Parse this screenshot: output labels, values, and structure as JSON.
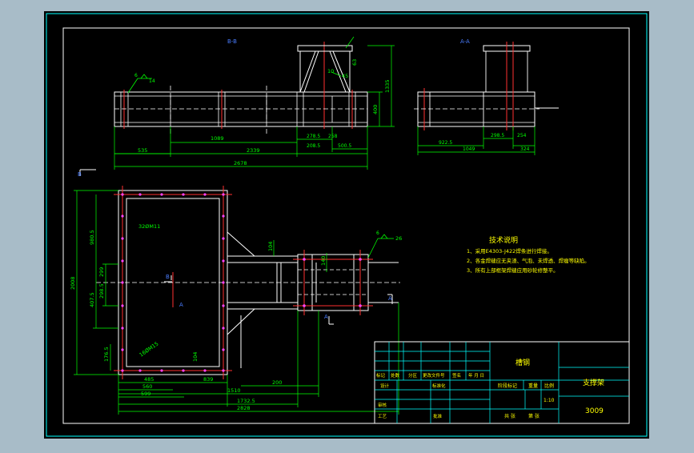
{
  "colors": {
    "background": "#a8bcc8",
    "canvas": "#000000",
    "frame": "#00ffff",
    "drawing": "#ffffff",
    "dimension": "#00ff00",
    "centerline": "#ff0000",
    "note_text": "#ffff00",
    "label_blue": "#4a7dff",
    "holes": "#ff00ff"
  },
  "views": {
    "front_label": "B-B",
    "side_label": "A-A",
    "section_a": "A",
    "section_b": "B"
  },
  "front_view": {
    "weld_symbol": "14",
    "weld_symbol_2": "6",
    "dims": {
      "d1089": "1089",
      "d2339": "2339",
      "d2678": "2678",
      "d535": "535",
      "d278_5": "278.5",
      "d258": "258",
      "d208_5": "208.5",
      "d500_5": "500.5",
      "d1335": "1335",
      "d400": "400",
      "d10": "10",
      "d45": "45",
      "d63": "63"
    }
  },
  "side_view": {
    "dims": {
      "d922_5": "922.5",
      "d1049": "1049",
      "d298_5": "298.5",
      "d254": "254",
      "d324": "324"
    }
  },
  "plan_view": {
    "hole_label_top": "32ØM11",
    "hole_label_bottom": "16ØM15",
    "weld_symbol": "26",
    "weld_symbol_2": "6",
    "dims": {
      "d2008": "2008",
      "d980_5": "980.5",
      "d407_5": "407.5",
      "d299": "299",
      "d298_5": "298.5",
      "d176_5": "176.5",
      "d485": "485",
      "d560": "560",
      "d599": "599",
      "d839": "839",
      "d1510": "1510",
      "d200": "200",
      "d1732_5": "1732.5",
      "d2828": "2828",
      "d104": "104",
      "d104b": "104",
      "d140": "140"
    }
  },
  "notes": {
    "title": "技术说明",
    "items": [
      "1、采用E4303-J422焊条进行焊接。",
      "2、各金焊缝应无夹渣、气泡、未焊透、焊瘤等缺陷。",
      "3、所有上部框架焊缝应用砂轮修整平。"
    ]
  },
  "title_block": {
    "material": "槽钢",
    "drawing_name": "支撑架",
    "drawing_number": "3009",
    "scale_label": "比例",
    "scale_value": "1:10",
    "weight_label": "重量",
    "stage_label": "阶段标记",
    "sheets_total": "共  张",
    "sheet_no": "第  张",
    "row_labels": [
      "标记",
      "处数",
      "分区",
      "更改文件号",
      "签名",
      "年 月 日"
    ],
    "design": "设计",
    "standardize": "标准化",
    "check": "审核",
    "process": "工艺",
    "approve": "批准"
  }
}
